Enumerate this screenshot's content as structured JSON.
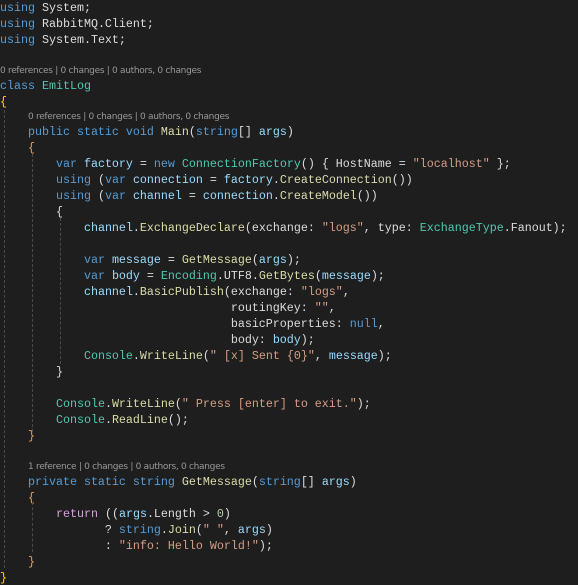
{
  "colors": {
    "background": "#1e1e1e",
    "keyword": "#569cd6",
    "type": "#4ec9b0",
    "method": "#dcdcaa",
    "string": "#d69d85",
    "variable": "#9cdcfe",
    "control": "#d8a0df",
    "codelens": "#999999"
  },
  "lines": [
    {
      "tokens": [
        [
          "k",
          "using"
        ],
        [
          "p",
          " System;"
        ]
      ]
    },
    {
      "tokens": [
        [
          "k",
          "using"
        ],
        [
          "p",
          " RabbitMQ.Client;"
        ]
      ]
    },
    {
      "tokens": [
        [
          "k",
          "using"
        ],
        [
          "p",
          " System.Text;"
        ]
      ]
    },
    {
      "tokens": []
    },
    {
      "lens": "0 references | 0 changes | 0 authors, 0 changes",
      "indent": ""
    },
    {
      "tokens": [
        [
          "k",
          "class"
        ],
        [
          "p",
          " "
        ],
        [
          "t",
          "EmitLog"
        ]
      ]
    },
    {
      "tokens": [
        [
          "b1",
          "{"
        ]
      ]
    },
    {
      "lens": "0 references | 0 changes | 0 authors, 0 changes",
      "indent": "    "
    },
    {
      "tokens": [
        [
          "p",
          "    "
        ],
        [
          "k",
          "public static void "
        ],
        [
          "m",
          "Main"
        ],
        [
          "p",
          "("
        ],
        [
          "k",
          "string"
        ],
        [
          "p",
          "[] "
        ],
        [
          "v",
          "args"
        ],
        [
          "p",
          ")"
        ]
      ]
    },
    {
      "tokens": [
        [
          "p",
          "    "
        ],
        [
          "b2",
          "{"
        ]
      ]
    },
    {
      "tokens": [
        [
          "p",
          "        "
        ],
        [
          "k",
          "var "
        ],
        [
          "v",
          "factory"
        ],
        [
          "p",
          " = "
        ],
        [
          "k",
          "new "
        ],
        [
          "t",
          "ConnectionFactory"
        ],
        [
          "p",
          "() { HostName = "
        ],
        [
          "s",
          "\"localhost\""
        ],
        [
          "p",
          " };"
        ]
      ]
    },
    {
      "tokens": [
        [
          "p",
          "        "
        ],
        [
          "k",
          "using"
        ],
        [
          "p",
          " ("
        ],
        [
          "k",
          "var "
        ],
        [
          "v",
          "connection"
        ],
        [
          "p",
          " = "
        ],
        [
          "v",
          "factory"
        ],
        [
          "p",
          "."
        ],
        [
          "m",
          "CreateConnection"
        ],
        [
          "p",
          "())"
        ]
      ]
    },
    {
      "tokens": [
        [
          "p",
          "        "
        ],
        [
          "k",
          "using"
        ],
        [
          "p",
          " ("
        ],
        [
          "k",
          "var "
        ],
        [
          "v",
          "channel"
        ],
        [
          "p",
          " = "
        ],
        [
          "v",
          "connection"
        ],
        [
          "p",
          "."
        ],
        [
          "m",
          "CreateModel"
        ],
        [
          "p",
          "())"
        ]
      ]
    },
    {
      "tokens": [
        [
          "p",
          "        {"
        ]
      ]
    },
    {
      "tokens": [
        [
          "p",
          "            "
        ],
        [
          "v",
          "channel"
        ],
        [
          "p",
          "."
        ],
        [
          "m",
          "ExchangeDeclare"
        ],
        [
          "p",
          "(exchange: "
        ],
        [
          "s",
          "\"logs\""
        ],
        [
          "p",
          ", type: "
        ],
        [
          "t",
          "ExchangeType"
        ],
        [
          "p",
          ".Fanout);"
        ]
      ]
    },
    {
      "tokens": []
    },
    {
      "tokens": [
        [
          "p",
          "            "
        ],
        [
          "k",
          "var "
        ],
        [
          "v",
          "message"
        ],
        [
          "p",
          " = "
        ],
        [
          "m",
          "GetMessage"
        ],
        [
          "p",
          "("
        ],
        [
          "v",
          "args"
        ],
        [
          "p",
          ");"
        ]
      ]
    },
    {
      "tokens": [
        [
          "p",
          "            "
        ],
        [
          "k",
          "var "
        ],
        [
          "v",
          "body"
        ],
        [
          "p",
          " = "
        ],
        [
          "t",
          "Encoding"
        ],
        [
          "p",
          ".UTF8."
        ],
        [
          "m",
          "GetBytes"
        ],
        [
          "p",
          "("
        ],
        [
          "v",
          "message"
        ],
        [
          "p",
          ");"
        ]
      ]
    },
    {
      "tokens": [
        [
          "p",
          "            "
        ],
        [
          "v",
          "channel"
        ],
        [
          "p",
          "."
        ],
        [
          "m",
          "BasicPublish"
        ],
        [
          "p",
          "(exchange: "
        ],
        [
          "s",
          "\"logs\""
        ],
        [
          "p",
          ","
        ]
      ]
    },
    {
      "tokens": [
        [
          "p",
          "                                 routingKey: "
        ],
        [
          "s",
          "\"\""
        ],
        [
          "p",
          ","
        ]
      ]
    },
    {
      "tokens": [
        [
          "p",
          "                                 basicProperties: "
        ],
        [
          "k",
          "null"
        ],
        [
          "p",
          ","
        ]
      ]
    },
    {
      "tokens": [
        [
          "p",
          "                                 body: "
        ],
        [
          "v",
          "body"
        ],
        [
          "p",
          ");"
        ]
      ]
    },
    {
      "tokens": [
        [
          "p",
          "            "
        ],
        [
          "t",
          "Console"
        ],
        [
          "p",
          "."
        ],
        [
          "m",
          "WriteLine"
        ],
        [
          "p",
          "("
        ],
        [
          "s",
          "\" [x] Sent {0}\""
        ],
        [
          "p",
          ", "
        ],
        [
          "v",
          "message"
        ],
        [
          "p",
          ");"
        ]
      ]
    },
    {
      "tokens": [
        [
          "p",
          "        }"
        ]
      ]
    },
    {
      "tokens": []
    },
    {
      "tokens": [
        [
          "p",
          "        "
        ],
        [
          "t",
          "Console"
        ],
        [
          "p",
          "."
        ],
        [
          "m",
          "WriteLine"
        ],
        [
          "p",
          "("
        ],
        [
          "s",
          "\" Press [enter] to exit.\""
        ],
        [
          "p",
          ");"
        ]
      ]
    },
    {
      "tokens": [
        [
          "p",
          "        "
        ],
        [
          "t",
          "Console"
        ],
        [
          "p",
          "."
        ],
        [
          "m",
          "ReadLine"
        ],
        [
          "p",
          "();"
        ]
      ]
    },
    {
      "tokens": [
        [
          "p",
          "    "
        ],
        [
          "b2",
          "}"
        ]
      ]
    },
    {
      "tokens": []
    },
    {
      "lens": "1 reference | 0 changes | 0 authors, 0 changes",
      "indent": "    "
    },
    {
      "tokens": [
        [
          "p",
          "    "
        ],
        [
          "k",
          "private static string "
        ],
        [
          "m",
          "GetMessage"
        ],
        [
          "p",
          "("
        ],
        [
          "k",
          "string"
        ],
        [
          "p",
          "[] "
        ],
        [
          "v",
          "args"
        ],
        [
          "p",
          ")"
        ]
      ]
    },
    {
      "tokens": [
        [
          "p",
          "    "
        ],
        [
          "b2",
          "{"
        ]
      ]
    },
    {
      "tokens": [
        [
          "p",
          "        "
        ],
        [
          "c",
          "return"
        ],
        [
          "p",
          " (("
        ],
        [
          "v",
          "args"
        ],
        [
          "p",
          ".Length > "
        ],
        [
          "n",
          "0"
        ],
        [
          "p",
          ")"
        ]
      ]
    },
    {
      "tokens": [
        [
          "p",
          "               ? "
        ],
        [
          "k",
          "string"
        ],
        [
          "p",
          "."
        ],
        [
          "m",
          "Join"
        ],
        [
          "p",
          "("
        ],
        [
          "s",
          "\" \""
        ],
        [
          "p",
          ", "
        ],
        [
          "v",
          "args"
        ],
        [
          "p",
          ")"
        ]
      ]
    },
    {
      "tokens": [
        [
          "p",
          "               : "
        ],
        [
          "s",
          "\"info: Hello World!\""
        ],
        [
          "p",
          ");"
        ]
      ]
    },
    {
      "tokens": [
        [
          "p",
          "    "
        ],
        [
          "b2",
          "}"
        ]
      ]
    },
    {
      "tokens": [
        [
          "b1",
          "}"
        ]
      ]
    }
  ]
}
